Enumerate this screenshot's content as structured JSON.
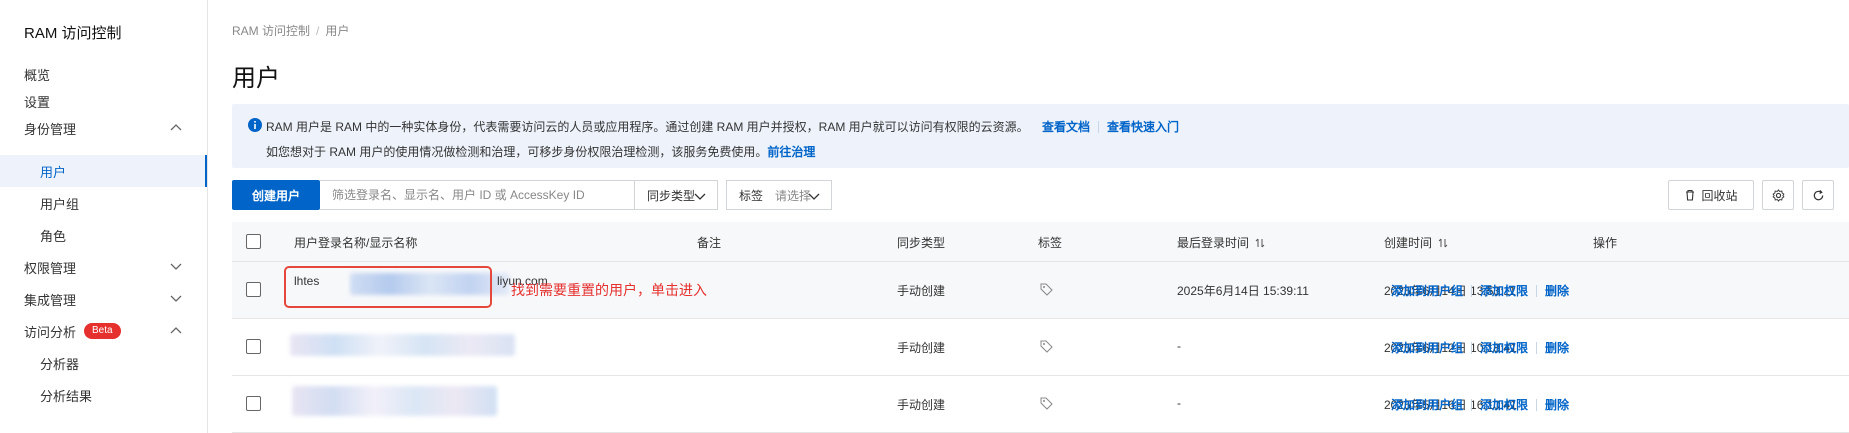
{
  "sidebar": {
    "title": "RAM 访问控制",
    "items": [
      {
        "label": "概览"
      },
      {
        "label": "设置"
      },
      {
        "label": "身份管理"
      },
      {
        "label": "用户"
      },
      {
        "label": "用户组"
      },
      {
        "label": "角色"
      },
      {
        "label": "权限管理"
      },
      {
        "label": "集成管理"
      },
      {
        "label": "访问分析",
        "badge": "Beta"
      },
      {
        "label": "分析器"
      },
      {
        "label": "分析结果"
      }
    ]
  },
  "breadcrumb": {
    "root": "RAM 访问控制",
    "current": "用户"
  },
  "page_title": "用户",
  "notice": {
    "line1_text": "RAM 用户是 RAM 中的一种实体身份，代表需要访问云的人员或应用程序。通过创建 RAM 用户并授权，RAM 用户就可以访问有权限的云资源。",
    "link_docs": "查看文档",
    "link_quickstart": "查看快速入门",
    "line2_text": "如您想对于 RAM 用户的使用情况做检测和治理，可移步身份权限治理检测，该服务免费使用。",
    "link_govern": "前往治理"
  },
  "toolbar": {
    "create_label": "创建用户",
    "search_placeholder": "筛选登录名、显示名、用户 ID 或 AccessKey ID",
    "sync_type_label": "同步类型",
    "tag_label": "标签",
    "tag_placeholder": "请选择",
    "recycle_label": "回收站"
  },
  "table": {
    "columns": [
      "用户登录名称/显示名称",
      "备注",
      "同步类型",
      "标签",
      "最后登录时间",
      "创建时间",
      "操作"
    ],
    "rows": [
      {
        "login_prefix": "lhtes",
        "login_suffix": "liyun.com",
        "sync_type": "手动创建",
        "last_login": "2025年6月14日 15:39:11",
        "created": "2025年6月14日 13:53:11"
      },
      {
        "login_prefix": "",
        "login_suffix": "",
        "sync_type": "手动创建",
        "last_login": "-",
        "created": "2025年6月12日 10:18:41"
      },
      {
        "login_prefix": "",
        "login_suffix": "",
        "sync_type": "手动创建",
        "last_login": "-",
        "created": "2025年5月16日 16:10:41"
      }
    ],
    "actions": {
      "add_to_group": "添加到用户组",
      "add_permission": "添加权限",
      "delete": "删除"
    }
  },
  "annotation": "找到需要重置的用户，单击进入",
  "colors": {
    "accent": "#0064c8",
    "annotation": "#e5302e",
    "notice_bg": "#eef3fb"
  }
}
